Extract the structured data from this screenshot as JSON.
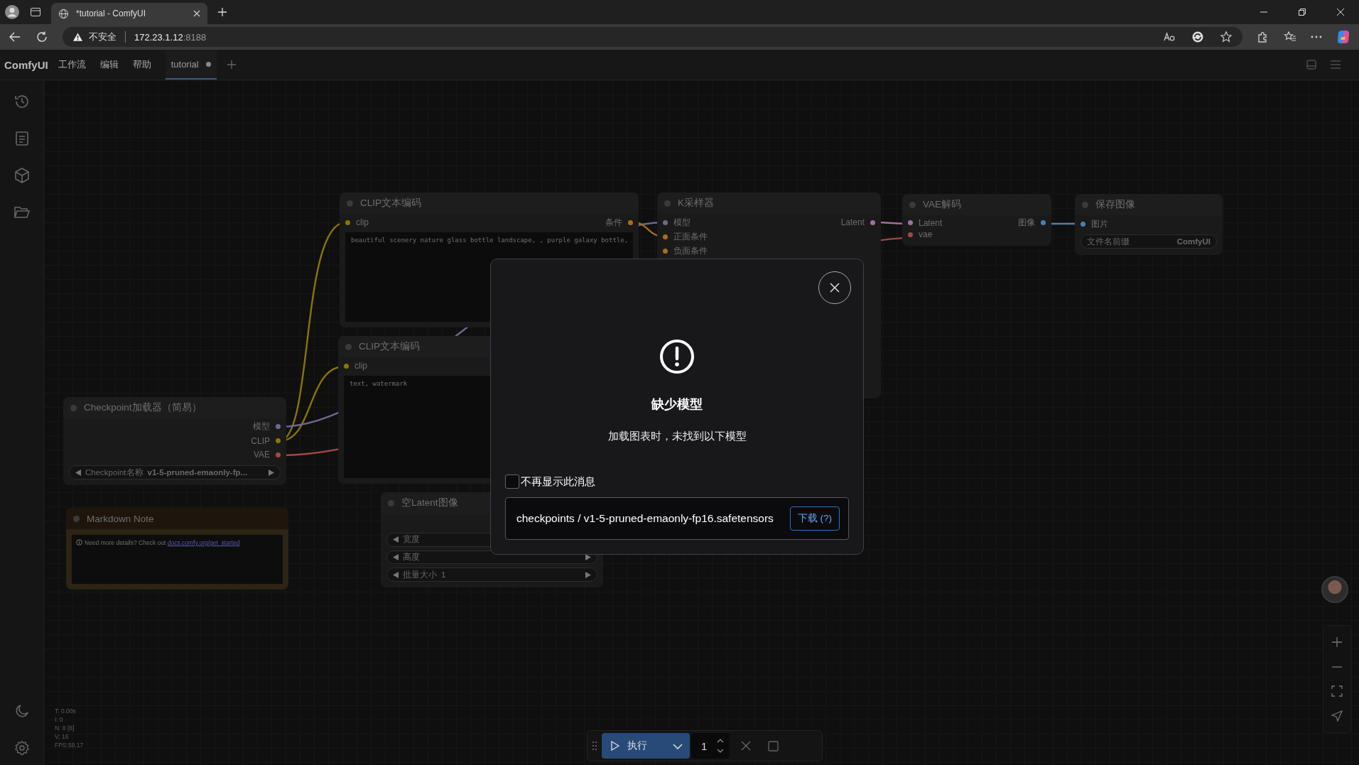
{
  "browser": {
    "tabs": [
      {
        "title": "*tutorial - ComfyUI",
        "selected": true
      }
    ],
    "address": {
      "warning": "不安全",
      "host": "172.23.1.12",
      "port": ":8188"
    }
  },
  "app_menu": {
    "logo": "ComfyUI",
    "menus": [
      "工作流",
      "编辑",
      "帮助"
    ],
    "tabs": [
      {
        "label": "tutorial",
        "selected": true,
        "modified": true
      }
    ]
  },
  "nodes": [
    {
      "kind": "node",
      "title": "CLIP文本编码",
      "inputs": [
        {
          "label": "clip",
          "color": "#8a7600"
        }
      ],
      "outputs": [
        {
          "label": "条件",
          "color": "#a86e1c"
        }
      ],
      "widgets": [
        {
          "kind": "textarea",
          "value": "beautiful scenery nature glass bottle landscape, , purple galaxy bottle,"
        }
      ]
    },
    {
      "kind": "node",
      "title": "CLIP文本编码",
      "inputs": [
        {
          "label": "clip",
          "color": "#8a7600"
        }
      ],
      "widgets": [
        {
          "kind": "textarea",
          "value": "text, watermark"
        }
      ]
    },
    {
      "kind": "node",
      "title": "Checkpoint加载器（简易）",
      "outputs": [
        {
          "label": "模型",
          "color": "#6e6890"
        },
        {
          "label": "CLIP",
          "color": "#8a7600"
        },
        {
          "label": "VAE",
          "color": "#a04848"
        }
      ],
      "widgets": [
        {
          "kind": "combo",
          "label": "Checkpoint名称",
          "value": "v1-5-pruned-emaonly-fp..."
        }
      ]
    },
    {
      "kind": "note",
      "title": "Markdown Note",
      "text": "Need more details? Check out ",
      "link": "docs.comfy.org/get_started"
    },
    {
      "kind": "node",
      "title": "空Latent图像",
      "widgets": [
        {
          "kind": "number",
          "label": "宽度"
        },
        {
          "kind": "number",
          "label": "高度"
        },
        {
          "kind": "number",
          "label": "批量大小",
          "value": "1"
        }
      ]
    },
    {
      "kind": "node",
      "title": "K采样器",
      "inputs": [
        {
          "label": "模型",
          "color": "#6e6890"
        },
        {
          "label": "正面条件",
          "color": "#a86e1c"
        },
        {
          "label": "负面条件",
          "color": "#a86e1c"
        }
      ],
      "outputs": [
        {
          "label": "Latent",
          "color": "#a070a0"
        }
      ]
    },
    {
      "kind": "node",
      "title": "VAE解码",
      "inputs": [
        {
          "label": "Latent",
          "color": "#a070a0"
        },
        {
          "label": "vae",
          "color": "#a04848"
        }
      ],
      "outputs": [
        {
          "label": "图像",
          "color": "#4a80b0"
        }
      ]
    },
    {
      "kind": "node",
      "title": "保存图像",
      "inputs": [
        {
          "label": "图片",
          "color": "#4a80b0"
        }
      ],
      "widgets": [
        {
          "kind": "text",
          "label": "文件名前缀",
          "value": "ComfyUI"
        }
      ]
    }
  ],
  "stats": [
    "T: 0.00s",
    "I: 0",
    "N: 8 [8]",
    "V: 16",
    "FPS:59.17"
  ],
  "dialog": {
    "title": "缺少模型",
    "message": "加载图表时，未找到以下模型",
    "dont_show_again": {
      "label": "不再显示此消息",
      "checked": false
    },
    "models": [
      {
        "path": "checkpoints / v1-5-pruned-emaonly-fp16.safetensors",
        "button": "下载 (?)"
      }
    ]
  },
  "run_toolbar": {
    "run": "执行",
    "count": "1"
  }
}
